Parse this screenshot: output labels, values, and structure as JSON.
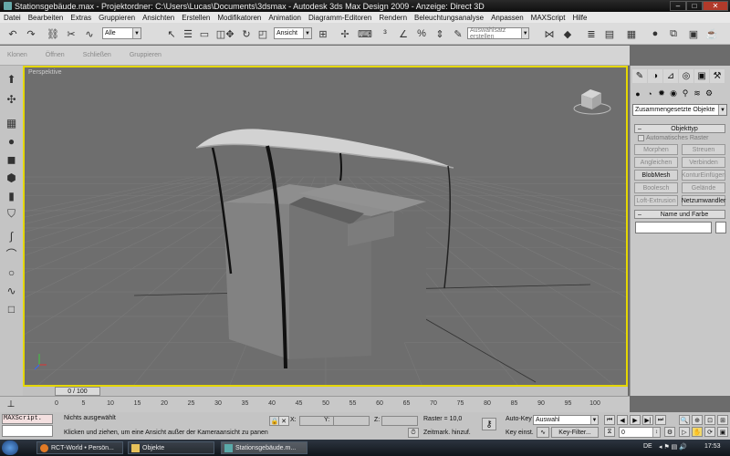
{
  "window": {
    "title": "Stationsgebäude.max    - Projektordner: C:\\Users\\Lucas\\Documents\\3dsmax    - Autodesk 3ds Max Design 2009     - Anzeige: Direct 3D",
    "minimize": "–",
    "maximize": "□",
    "close": "✕"
  },
  "menu": [
    "Datei",
    "Bearbeiten",
    "Extras",
    "Gruppieren",
    "Ansichten",
    "Erstellen",
    "Modifikatoren",
    "Animation",
    "Diagramm-Editoren",
    "Rendern",
    "Beleuchtungsanalyse",
    "Anpassen",
    "MAXScript",
    "Hilfe"
  ],
  "toolbar": {
    "selection_filter": "Alle",
    "ref_coord": "Ansicht",
    "named_selection": "Auswahlsatz erstellen"
  },
  "secondary_toolbar": [
    "Klonen",
    "Öffnen",
    "Schließen",
    "Gruppieren"
  ],
  "viewport": {
    "label": "Perspektive"
  },
  "command_panel": {
    "category": "Zusammengesetzte Objekte",
    "rollout_object_type": "Objekttyp",
    "auto_grid": "Automatisches Raster",
    "buttons": [
      {
        "label": "Morphen",
        "enabled": false
      },
      {
        "label": "Streuen",
        "enabled": false
      },
      {
        "label": "Angleichen",
        "enabled": false
      },
      {
        "label": "Verbinden",
        "enabled": false
      },
      {
        "label": "BlobMesh",
        "enabled": true
      },
      {
        "label": "KonturEinfügen",
        "enabled": false
      },
      {
        "label": "Boolesch",
        "enabled": false
      },
      {
        "label": "Gelände",
        "enabled": false
      },
      {
        "label": "Loft-Extrusion",
        "enabled": false
      },
      {
        "label": "Netzumwandler",
        "enabled": true
      }
    ],
    "rollout_name_color": "Name und Farbe",
    "name_value": ""
  },
  "time": {
    "slider_label": "0 / 100",
    "ticks": [
      "0",
      "5",
      "10",
      "15",
      "20",
      "25",
      "30",
      "35",
      "40",
      "45",
      "50",
      "55",
      "60",
      "65",
      "70",
      "75",
      "80",
      "85",
      "90",
      "95",
      "100"
    ]
  },
  "status": {
    "maxscript_label": "MAXScript.",
    "selection": "Nichts ausgewählt",
    "prompt": "Klicken und ziehen, um eine Ansicht außer der Kameraansicht zu panen",
    "x_label": "X:",
    "y_label": "Y:",
    "z_label": "Z:",
    "grid": "Raster = 10,0",
    "add_time_tag": "Zeitmark. hinzuf.",
    "auto_key": "Auto-Key",
    "auto_key_select": "Auswahl",
    "set_key": "Key einst.",
    "key_filter": "Key-Filter...",
    "frame_value": "0"
  },
  "taskbar": {
    "tasks": [
      "RCT-World • Persön...",
      "Objekte",
      "Stationsgebäude.m..."
    ],
    "lang": "DE",
    "clock": "17:53"
  }
}
